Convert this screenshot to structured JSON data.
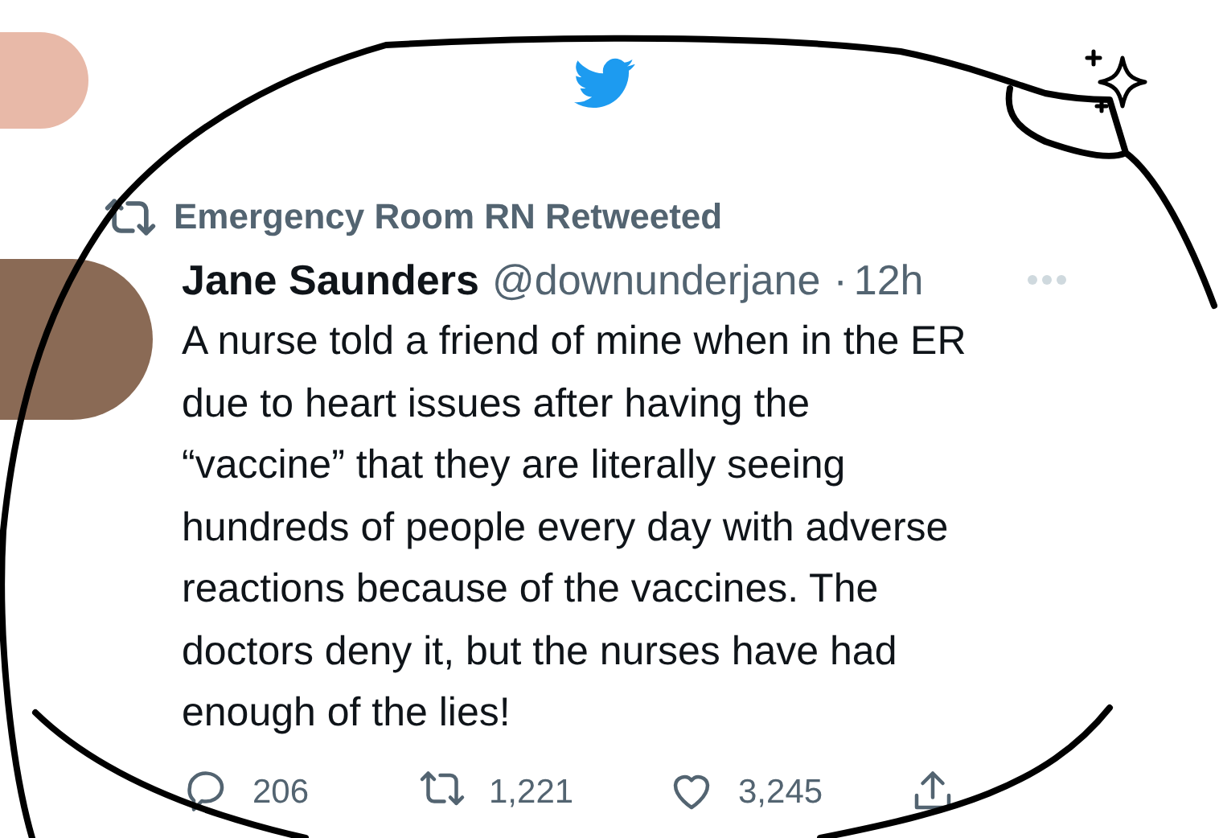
{
  "retweet_banner": {
    "text": "Emergency Room RN Retweeted"
  },
  "tweet": {
    "name": "Jane Saunders",
    "handle": "@downunderjane",
    "separator": "·",
    "time": "12h",
    "body": [
      "A nurse told a friend of mine when in the ER",
      "due to heart issues after having the",
      "“vaccine” that they are literally seeing",
      "hundreds of people every day with adverse",
      "reactions because of the vaccines. The",
      "doctors deny it, but the nurses have had",
      "enough of the lies!"
    ],
    "actions": [
      {
        "kind": "reply",
        "count": "206"
      },
      {
        "kind": "retweet",
        "count": "1,221"
      },
      {
        "kind": "like",
        "count": "3,245"
      },
      {
        "kind": "share"
      }
    ]
  }
}
